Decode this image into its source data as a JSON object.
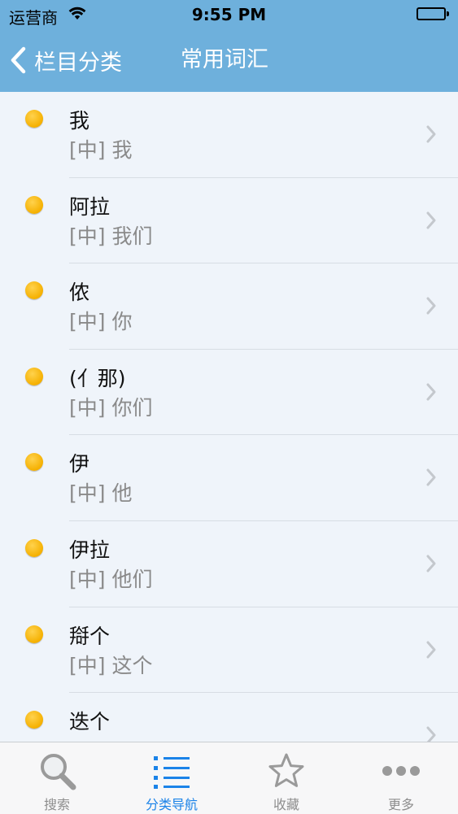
{
  "status_bar": {
    "carrier": "运营商",
    "time": "9:55 PM"
  },
  "nav": {
    "back_label": "栏目分类",
    "title": "常用词汇"
  },
  "items": [
    {
      "word": "我",
      "translation": "[中] 我"
    },
    {
      "word": "阿拉",
      "translation": "[中] 我们"
    },
    {
      "word": "侬",
      "translation": "[中] 你"
    },
    {
      "word": "(亻那)",
      "translation": "[中] 你们"
    },
    {
      "word": "伊",
      "translation": "[中] 他"
    },
    {
      "word": "伊拉",
      "translation": "[中] 他们"
    },
    {
      "word": "搿个",
      "translation": "[中] 这个"
    },
    {
      "word": "迭个",
      "translation": ""
    }
  ],
  "tabs": [
    {
      "label": "搜索",
      "icon": "search-icon"
    },
    {
      "label": "分类导航",
      "icon": "list-icon",
      "active": true
    },
    {
      "label": "收藏",
      "icon": "star-icon"
    },
    {
      "label": "更多",
      "icon": "more-icon"
    }
  ],
  "colors": {
    "header": "#6eb0dc",
    "accent": "#1b83e8",
    "bullet": "#f5b000"
  }
}
